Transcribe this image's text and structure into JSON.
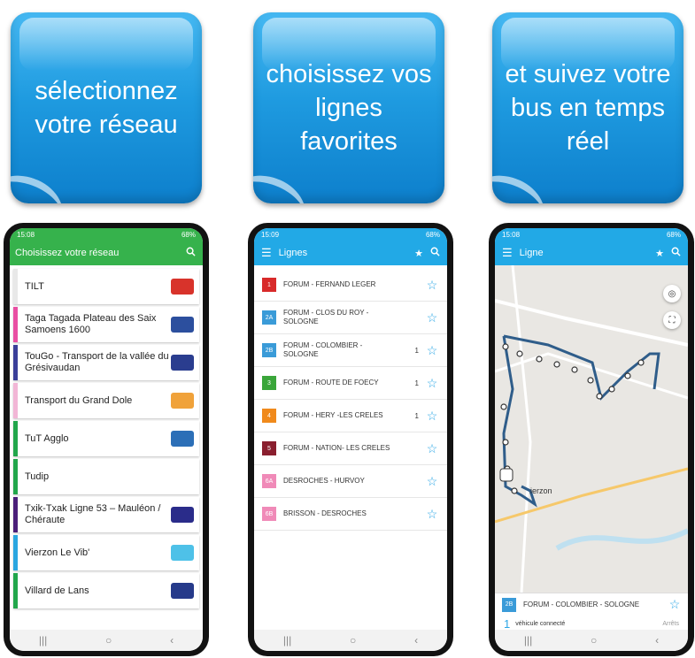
{
  "tiles": [
    {
      "text": "sélectionnez votre réseau"
    },
    {
      "text": "choisissez vos lignes favorites"
    },
    {
      "text": "et suivez votre bus en temps réel"
    }
  ],
  "phone1": {
    "time": "15:08",
    "battery": "68%",
    "title": "Choisissez votre réseau",
    "networks": [
      {
        "name": "TILT",
        "color": "#e8e8e8",
        "logo": "#d8332b"
      },
      {
        "name": "Taga Tagada Plateau des Saix Samoens 1600",
        "color": "#e94ea3",
        "logo": "#2c4f9e"
      },
      {
        "name": "TouGo - Transport de la vallée du Grésivaudan",
        "color": "#3b3f99",
        "logo": "#2a3d8f"
      },
      {
        "name": "Transport du Grand Dole",
        "color": "#f2b6d6",
        "logo": "#f0a23a"
      },
      {
        "name": "TuT Agglo",
        "color": "#22a64b",
        "logo": "#2c6fb7"
      },
      {
        "name": "Tudip",
        "color": "#22a64b",
        "logo": ""
      },
      {
        "name": "Txik-Txak Ligne 53 – Mauléon / Chéraute",
        "color": "#4b1f7a",
        "logo": "#2a2c8a"
      },
      {
        "name": "Vierzon Le Vib'",
        "color": "#2aa6e0",
        "logo": "#4ec1e8"
      },
      {
        "name": "Villard de Lans",
        "color": "#22a64b",
        "logo": "#263a8a"
      }
    ]
  },
  "phone2": {
    "time": "15:09",
    "battery": "68%",
    "title": "Lignes",
    "lines": [
      {
        "code": "1",
        "color": "#d82a2a",
        "name": "FORUM - FERNAND LEGER",
        "vehicles": ""
      },
      {
        "code": "2A",
        "color": "#3a9bd8",
        "name": "FORUM - CLOS DU ROY - SOLOGNE",
        "vehicles": ""
      },
      {
        "code": "2B",
        "color": "#3a9bd8",
        "name": "FORUM - COLOMBIER - SOLOGNE",
        "vehicles": "1"
      },
      {
        "code": "3",
        "color": "#3aa63a",
        "name": "FORUM - ROUTE DE FOECY",
        "vehicles": "1"
      },
      {
        "code": "4",
        "color": "#f08a1c",
        "name": "FORUM - HERY -LES CRELES",
        "vehicles": "1"
      },
      {
        "code": "5",
        "color": "#8a1f2f",
        "name": "FORUM - NATION- LES CRELES",
        "vehicles": ""
      },
      {
        "code": "6A",
        "color": "#f08ab8",
        "name": "DESROCHES - HURVOY",
        "vehicles": ""
      },
      {
        "code": "6B",
        "color": "#f08ab8",
        "name": "BRISSON - DESROCHES",
        "vehicles": ""
      }
    ]
  },
  "phone3": {
    "time": "15:08",
    "battery": "68%",
    "title": "Ligne",
    "map_label": "ierzon",
    "line_code": "2B",
    "line_name": "FORUM - COLOMBIER - SOLOGNE",
    "vehicle_count": "1",
    "vehicle_text": "véhicule connecté",
    "arrets": "Arrêts"
  }
}
